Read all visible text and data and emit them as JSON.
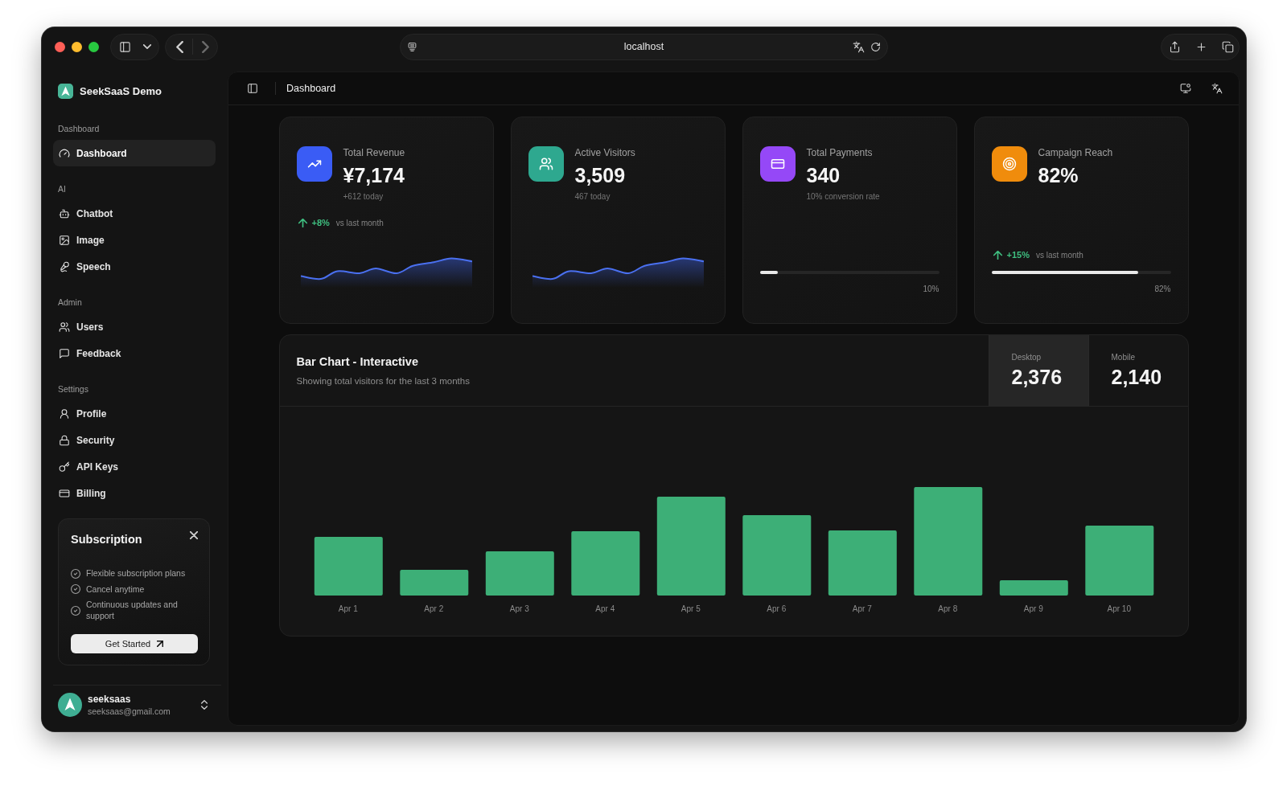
{
  "browser": {
    "url": "localhost"
  },
  "sidebar": {
    "brand": "SeekSaaS Demo",
    "groups": [
      {
        "label": "Dashboard",
        "items": [
          {
            "label": "Dashboard",
            "selected": true
          }
        ]
      },
      {
        "label": "AI",
        "items": [
          {
            "label": "Chatbot",
            "selected": false
          },
          {
            "label": "Image",
            "selected": false
          },
          {
            "label": "Speech",
            "selected": false
          }
        ]
      },
      {
        "label": "Admin",
        "items": [
          {
            "label": "Users",
            "selected": false
          },
          {
            "label": "Feedback",
            "selected": false
          }
        ]
      },
      {
        "label": "Settings",
        "items": [
          {
            "label": "Profile",
            "selected": false
          },
          {
            "label": "Security",
            "selected": false
          },
          {
            "label": "API Keys",
            "selected": false
          },
          {
            "label": "Billing",
            "selected": false
          }
        ]
      }
    ],
    "promo": {
      "title": "Subscription",
      "features": [
        "Flexible subscription plans",
        "Cancel anytime",
        "Continuous updates and support"
      ],
      "button": "Get Started"
    },
    "user": {
      "name": "seeksaas",
      "email": "seeksaas@gmail.com"
    }
  },
  "header": {
    "title": "Dashboard"
  },
  "stat_cards": [
    {
      "kind": "sparkline",
      "title": "Total Revenue",
      "value": "¥7,174",
      "note": "+612 today",
      "color": "#3a5cf5",
      "change": {
        "value": "+8%",
        "note": "vs last month"
      }
    },
    {
      "kind": "sparkline",
      "title": "Active Visitors",
      "value": "3,509",
      "note": "467 today",
      "color": "#2ea88f"
    },
    {
      "kind": "progress",
      "title": "Total Payments",
      "value": "340",
      "note": "10% conversion rate",
      "color": "#9548f7",
      "level": 0.1,
      "reading": "10%"
    },
    {
      "kind": "progress",
      "title": "Campaign Reach",
      "value": "82%",
      "color": "#f08c0c",
      "change": {
        "value": "+15%",
        "note": "vs last month"
      },
      "level": 0.82,
      "reading": "82%"
    }
  ],
  "bar_chart": {
    "title": "Bar Chart - Interactive",
    "subtitle": "Showing total visitors for the last 3 months",
    "totals": [
      {
        "label": "Desktop",
        "value": "2,376",
        "selected": true
      },
      {
        "label": "Mobile",
        "value": "2,140",
        "selected": false
      }
    ],
    "x_labels": [
      "Apr 1",
      "Apr 2",
      "Apr 3",
      "Apr 4",
      "Apr 5",
      "Apr 6",
      "Apr 7",
      "Apr 8",
      "Apr 9",
      "Apr 10"
    ]
  }
}
